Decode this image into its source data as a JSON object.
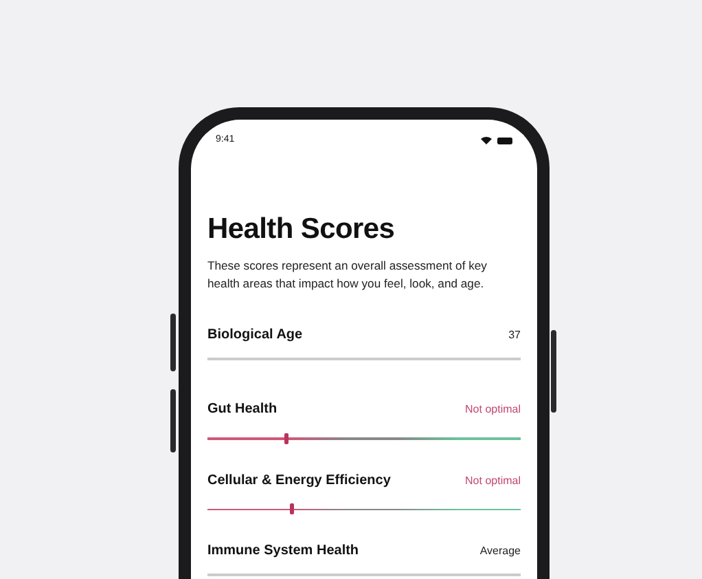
{
  "status_bar": {
    "time": "9:41"
  },
  "title": "Health Scores",
  "description": "These scores represent an overall assessment of key health areas that impact how you feel, look, and age.",
  "scores": [
    {
      "kind": "value",
      "name": "Biological Age",
      "reading": "37",
      "color": "#222222"
    },
    {
      "kind": "meter",
      "name": "Gut Health",
      "reading": "Not optimal",
      "color": "#c2476f",
      "level": 0.25
    },
    {
      "kind": "meter",
      "name": "Cellular & Energy Efficiency",
      "reading": "Not optimal",
      "color": "#c2476f",
      "level": 0.27
    },
    {
      "kind": "value",
      "name": "Immune System Health",
      "reading": "Average",
      "color": "#222222"
    }
  ]
}
